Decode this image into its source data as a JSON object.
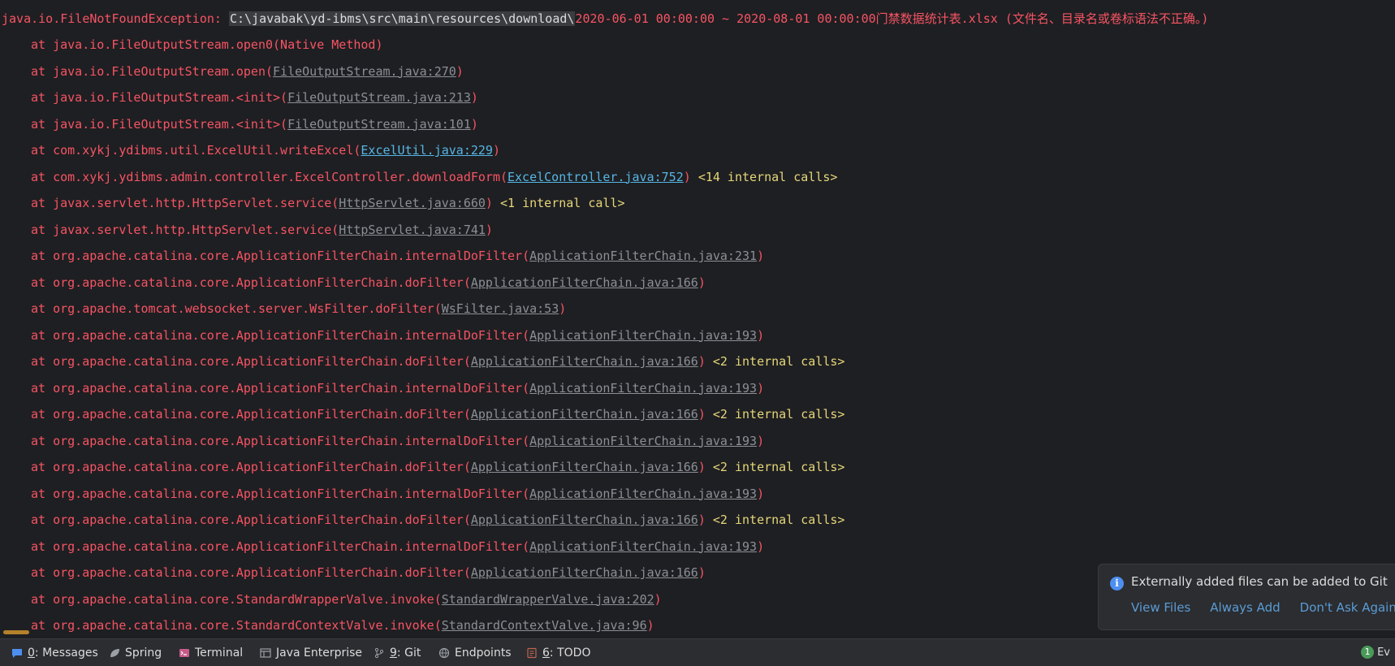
{
  "console": {
    "header": {
      "exception": "java.io.FileNotFoundException: ",
      "path": "C:\\javabak\\yd-ibms\\src\\main\\resources\\download\\",
      "rest": "2020-06-01 00:00:00 ~ 2020-08-01 00:00:00门禁数据统计表.xlsx (文件名、目录名或卷标语法不正确。)"
    },
    "frames": [
      {
        "method": "at java.io.FileOutputStream.open0",
        "link": "",
        "plain": "Native Method",
        "internal": ""
      },
      {
        "method": "at java.io.FileOutputStream.open",
        "link": "FileOutputStream.java:270",
        "plain": "",
        "internal": ""
      },
      {
        "method": "at java.io.FileOutputStream.<init>",
        "link": "FileOutputStream.java:213",
        "plain": "",
        "internal": ""
      },
      {
        "method": "at java.io.FileOutputStream.<init>",
        "link": "FileOutputStream.java:101",
        "plain": "",
        "internal": ""
      },
      {
        "method": "at com.xykj.ydibms.util.ExcelUtil.writeExcel",
        "link": "ExcelUtil.java:229",
        "plain": "",
        "internal": "",
        "bright": true
      },
      {
        "method": "at com.xykj.ydibms.admin.controller.ExcelController.downloadForm",
        "link": "ExcelController.java:752",
        "plain": "",
        "internal": "<14 internal calls>",
        "bright": true
      },
      {
        "method": "at javax.servlet.http.HttpServlet.service",
        "link": "HttpServlet.java:660",
        "plain": "",
        "internal": "<1 internal call>"
      },
      {
        "method": "at javax.servlet.http.HttpServlet.service",
        "link": "HttpServlet.java:741",
        "plain": "",
        "internal": ""
      },
      {
        "method": "at org.apache.catalina.core.ApplicationFilterChain.internalDoFilter",
        "link": "ApplicationFilterChain.java:231",
        "plain": "",
        "internal": ""
      },
      {
        "method": "at org.apache.catalina.core.ApplicationFilterChain.doFilter",
        "link": "ApplicationFilterChain.java:166",
        "plain": "",
        "internal": ""
      },
      {
        "method": "at org.apache.tomcat.websocket.server.WsFilter.doFilter",
        "link": "WsFilter.java:53",
        "plain": "",
        "internal": ""
      },
      {
        "method": "at org.apache.catalina.core.ApplicationFilterChain.internalDoFilter",
        "link": "ApplicationFilterChain.java:193",
        "plain": "",
        "internal": ""
      },
      {
        "method": "at org.apache.catalina.core.ApplicationFilterChain.doFilter",
        "link": "ApplicationFilterChain.java:166",
        "plain": "",
        "internal": "<2 internal calls>"
      },
      {
        "method": "at org.apache.catalina.core.ApplicationFilterChain.internalDoFilter",
        "link": "ApplicationFilterChain.java:193",
        "plain": "",
        "internal": ""
      },
      {
        "method": "at org.apache.catalina.core.ApplicationFilterChain.doFilter",
        "link": "ApplicationFilterChain.java:166",
        "plain": "",
        "internal": "<2 internal calls>"
      },
      {
        "method": "at org.apache.catalina.core.ApplicationFilterChain.internalDoFilter",
        "link": "ApplicationFilterChain.java:193",
        "plain": "",
        "internal": ""
      },
      {
        "method": "at org.apache.catalina.core.ApplicationFilterChain.doFilter",
        "link": "ApplicationFilterChain.java:166",
        "plain": "",
        "internal": "<2 internal calls>"
      },
      {
        "method": "at org.apache.catalina.core.ApplicationFilterChain.internalDoFilter",
        "link": "ApplicationFilterChain.java:193",
        "plain": "",
        "internal": ""
      },
      {
        "method": "at org.apache.catalina.core.ApplicationFilterChain.doFilter",
        "link": "ApplicationFilterChain.java:166",
        "plain": "",
        "internal": "<2 internal calls>"
      },
      {
        "method": "at org.apache.catalina.core.ApplicationFilterChain.internalDoFilter",
        "link": "ApplicationFilterChain.java:193",
        "plain": "",
        "internal": ""
      },
      {
        "method": "at org.apache.catalina.core.ApplicationFilterChain.doFilter",
        "link": "ApplicationFilterChain.java:166",
        "plain": "",
        "internal": ""
      },
      {
        "method": "at org.apache.catalina.core.StandardWrapperValve.invoke",
        "link": "StandardWrapperValve.java:202",
        "plain": "",
        "internal": ""
      },
      {
        "method": "at org.apache.catalina.core.StandardContextValve.invoke",
        "link": "StandardContextValve.java:96",
        "plain": "",
        "internal": ""
      }
    ]
  },
  "notification": {
    "icon": "info-icon",
    "message": "Externally added files can be added to Git",
    "actions": [
      "View Files",
      "Always Add",
      "Don't Ask Again"
    ]
  },
  "toolbar": {
    "items": [
      {
        "icon": "messages-icon",
        "mnemonic": "0",
        "label": ": Messages"
      },
      {
        "icon": "spring-icon",
        "mnemonic": "",
        "label": "Spring"
      },
      {
        "icon": "terminal-icon",
        "mnemonic": "",
        "label": "Terminal"
      },
      {
        "icon": "java-enterprise-icon",
        "mnemonic": "",
        "label": "Java Enterprise"
      },
      {
        "icon": "git-branch-icon",
        "mnemonic": "9",
        "label": ": Git"
      },
      {
        "icon": "endpoints-icon",
        "mnemonic": "",
        "label": "Endpoints"
      },
      {
        "icon": "todo-icon",
        "mnemonic": "6",
        "label": ": TODO"
      }
    ],
    "event_count": "1",
    "event_label": "Ev"
  },
  "colors": {
    "background": "#1e1f22",
    "error_text": "#f75464",
    "link_text": "#8b8f96",
    "project_link": "#56b6e6",
    "internal_calls": "#e6d67a",
    "accent_link": "#5b9bd5"
  }
}
